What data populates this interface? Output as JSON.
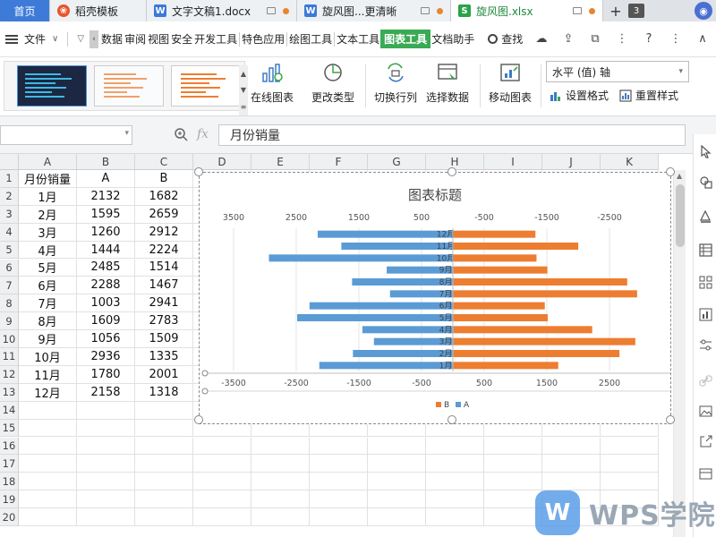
{
  "tabs": [
    {
      "label": "首页",
      "icon": ""
    },
    {
      "label": "稻壳模板",
      "icon": "docer-icon"
    },
    {
      "label": "文字文稿1.docx",
      "icon": "writer-icon"
    },
    {
      "label": "旋风图...更清晰",
      "icon": "writer-icon"
    },
    {
      "label": "旋风图.xlsx",
      "icon": "sheet-icon"
    }
  ],
  "tab_count": "3",
  "menu": {
    "file": "文件",
    "items": [
      "数据",
      "审阅",
      "视图",
      "安全",
      "开发工具",
      "特色应用",
      "绘图工具",
      "文本工具",
      "图表工具",
      "文档助手"
    ],
    "active": "图表工具",
    "search": "查找"
  },
  "ribbon": {
    "online_chart": "在线图表",
    "change_type": "更改类型",
    "switch_rowcol": "切换行列",
    "select_data": "选择数据",
    "move_chart": "移动图表",
    "axis_select": "水平 (值) 轴",
    "set_format": "设置格式",
    "reset_style": "重置样式"
  },
  "formula": {
    "fx": "fx",
    "content": "月份销量"
  },
  "columns": [
    "A",
    "B",
    "C",
    "D",
    "E",
    "F",
    "G",
    "H",
    "I",
    "J",
    "K"
  ],
  "rows": [
    "1",
    "2",
    "3",
    "4",
    "5",
    "6",
    "7",
    "8",
    "9",
    "10",
    "11",
    "12",
    "13",
    "14",
    "15",
    "16",
    "17",
    "18",
    "19",
    "20"
  ],
  "table": {
    "headers": [
      "月份销量",
      "A",
      "B"
    ],
    "rows": [
      [
        "1月",
        "2132",
        "1682"
      ],
      [
        "2月",
        "1595",
        "2659"
      ],
      [
        "3月",
        "1260",
        "2912"
      ],
      [
        "4月",
        "1444",
        "2224"
      ],
      [
        "5月",
        "2485",
        "1514"
      ],
      [
        "6月",
        "2288",
        "1467"
      ],
      [
        "7月",
        "1003",
        "2941"
      ],
      [
        "8月",
        "1609",
        "2783"
      ],
      [
        "9月",
        "1056",
        "1509"
      ],
      [
        "10月",
        "2936",
        "1335"
      ],
      [
        "11月",
        "1780",
        "2001"
      ],
      [
        "12月",
        "2158",
        "1318"
      ]
    ]
  },
  "chart_data": {
    "type": "bar",
    "orientation": "horizontal",
    "title": "图表标题",
    "categories": [
      "1月",
      "2月",
      "3月",
      "4月",
      "5月",
      "6月",
      "7月",
      "8月",
      "9月",
      "10月",
      "11月",
      "12月"
    ],
    "series": [
      {
        "name": "A",
        "values": [
          2132,
          1595,
          1260,
          1444,
          2485,
          2288,
          1003,
          1609,
          1056,
          2936,
          1780,
          2158
        ],
        "color": "#5b9bd5",
        "axis": "secondary",
        "direction": "left"
      },
      {
        "name": "B",
        "values": [
          1682,
          2659,
          2912,
          2224,
          1514,
          1467,
          2941,
          2783,
          1509,
          1335,
          2001,
          1318
        ],
        "color": "#ed7d31",
        "axis": "primary",
        "direction": "right"
      }
    ],
    "top_axis_ticks": [
      "3500",
      "2500",
      "1500",
      "500",
      "-500",
      "-1500",
      "-2500"
    ],
    "bottom_axis_ticks": [
      "-3500",
      "-2500",
      "-1500",
      "-500",
      "500",
      "1500",
      "2500"
    ],
    "xlim": [
      -3500,
      3500
    ],
    "legend": [
      "B",
      "A"
    ],
    "legend_position": "bottom"
  },
  "watermark": "WPS学院"
}
